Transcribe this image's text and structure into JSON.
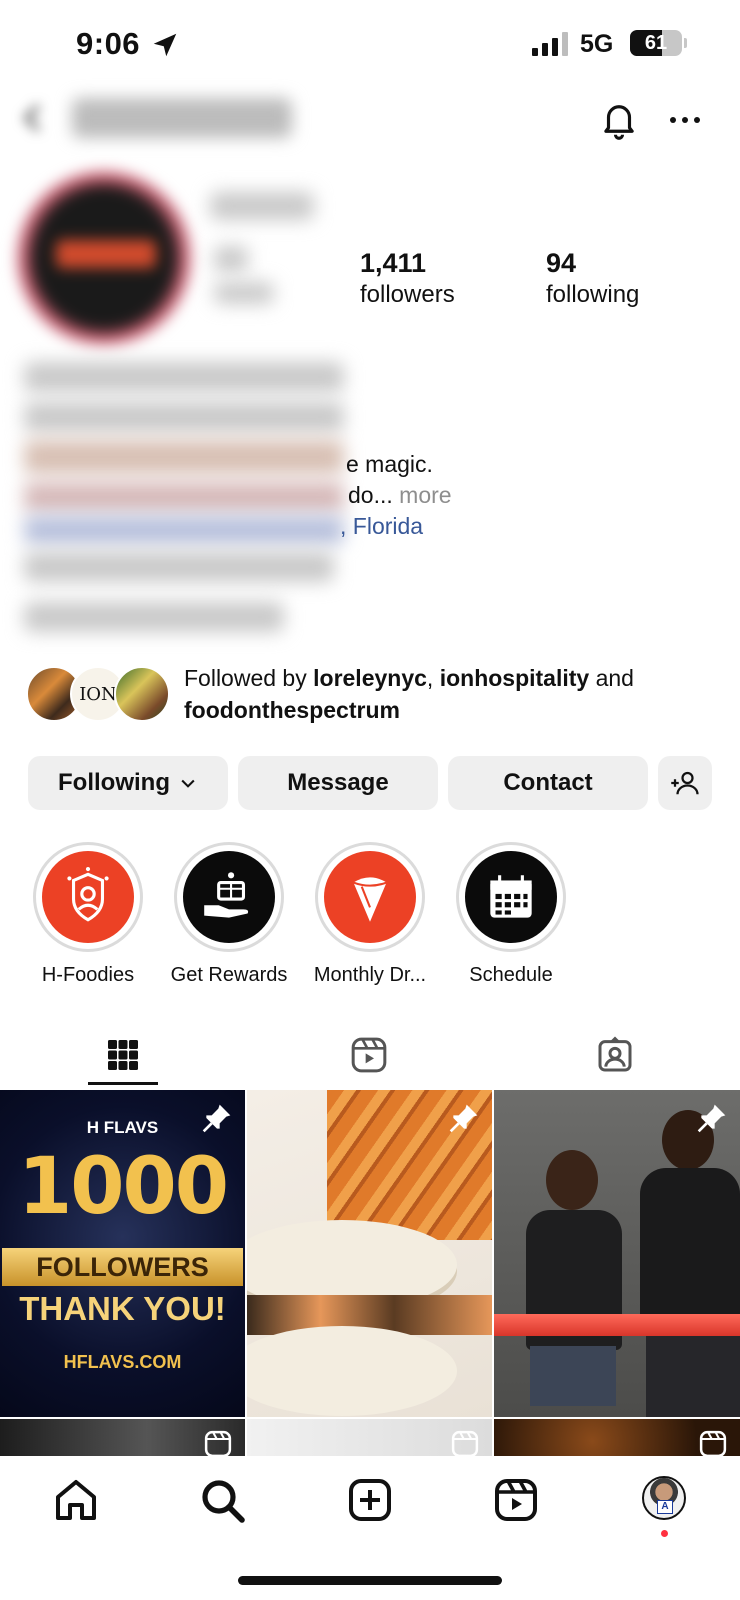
{
  "status_bar": {
    "time": "9:06",
    "network": "5G",
    "battery": "61",
    "battery_level": 0.61
  },
  "profile": {
    "followers_count": "1,411",
    "followers_label": "followers",
    "following_count": "94",
    "following_label": "following",
    "bio_visible_1": "e magic.",
    "bio_visible_2": "do...",
    "bio_more": "more",
    "bio_location": ", Florida"
  },
  "followed_by": {
    "prefix": "Followed by ",
    "user1": "loreleynyc",
    "separator": ", ",
    "user2": "ionhospitality",
    "and": " and",
    "user3": "foodonthespectrum"
  },
  "actions": {
    "following_label": "Following",
    "message_label": "Message",
    "contact_label": "Contact"
  },
  "highlights": [
    {
      "label": "H-Foodies",
      "color": "#ec4125"
    },
    {
      "label": "Get Rewards",
      "color": "#0b0b0b"
    },
    {
      "label": "Monthly Dr...",
      "color": "#ec4125"
    },
    {
      "label": "Schedule",
      "color": "#0b0b0b"
    }
  ],
  "posts": {
    "post1": {
      "brand": "H FLAVS",
      "big": "1000",
      "line1": "FOLLOWERS",
      "line2": "THANK YOU!",
      "site": "HFLAVS.COM"
    }
  },
  "icons": {
    "header": [
      "back-arrow-icon",
      "bell-icon",
      "more-icon"
    ],
    "tabs": [
      "grid-icon",
      "reels-icon",
      "tagged-icon"
    ],
    "nav": [
      "home-icon",
      "search-icon",
      "create-icon",
      "reels-icon",
      "profile-avatar"
    ]
  },
  "colors": {
    "accent_orange": "#ec4125",
    "link": "#385898",
    "muted": "#8e8e8e"
  }
}
